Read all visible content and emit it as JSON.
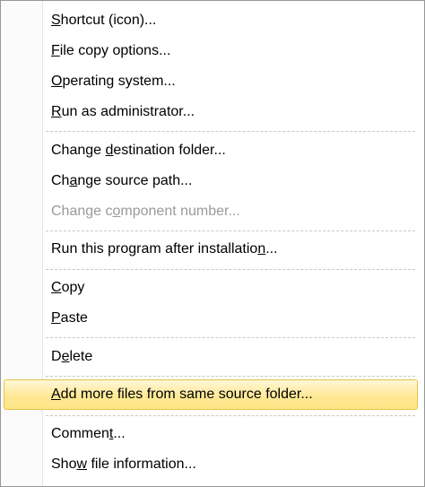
{
  "menu": {
    "items": [
      {
        "pre": "",
        "acc": "S",
        "post": "hortcut (icon)...",
        "disabled": false,
        "highlighted": false
      },
      {
        "pre": "",
        "acc": "F",
        "post": "ile copy options...",
        "disabled": false,
        "highlighted": false
      },
      {
        "pre": "",
        "acc": "O",
        "post": "perating system...",
        "disabled": false,
        "highlighted": false
      },
      {
        "pre": "",
        "acc": "R",
        "post": "un as administrator...",
        "disabled": false,
        "highlighted": false
      },
      {
        "pre": "Change ",
        "acc": "d",
        "post": "estination folder...",
        "disabled": false,
        "highlighted": false
      },
      {
        "pre": "Ch",
        "acc": "a",
        "post": "nge source path...",
        "disabled": false,
        "highlighted": false
      },
      {
        "pre": "Change c",
        "acc": "o",
        "post": "mponent number...",
        "disabled": true,
        "highlighted": false
      },
      {
        "pre": "Run this program after installatio",
        "acc": "n",
        "post": "...",
        "disabled": false,
        "highlighted": false
      },
      {
        "pre": "",
        "acc": "C",
        "post": "opy",
        "disabled": false,
        "highlighted": false
      },
      {
        "pre": "",
        "acc": "P",
        "post": "aste",
        "disabled": false,
        "highlighted": false
      },
      {
        "pre": "D",
        "acc": "e",
        "post": "lete",
        "disabled": false,
        "highlighted": false
      },
      {
        "pre": "",
        "acc": "A",
        "post": "dd more files from same source folder...",
        "disabled": false,
        "highlighted": true
      },
      {
        "pre": "Commen",
        "acc": "t",
        "post": "...",
        "disabled": false,
        "highlighted": false
      },
      {
        "pre": "Sho",
        "acc": "w",
        "post": " file information...",
        "disabled": false,
        "highlighted": false
      }
    ]
  }
}
